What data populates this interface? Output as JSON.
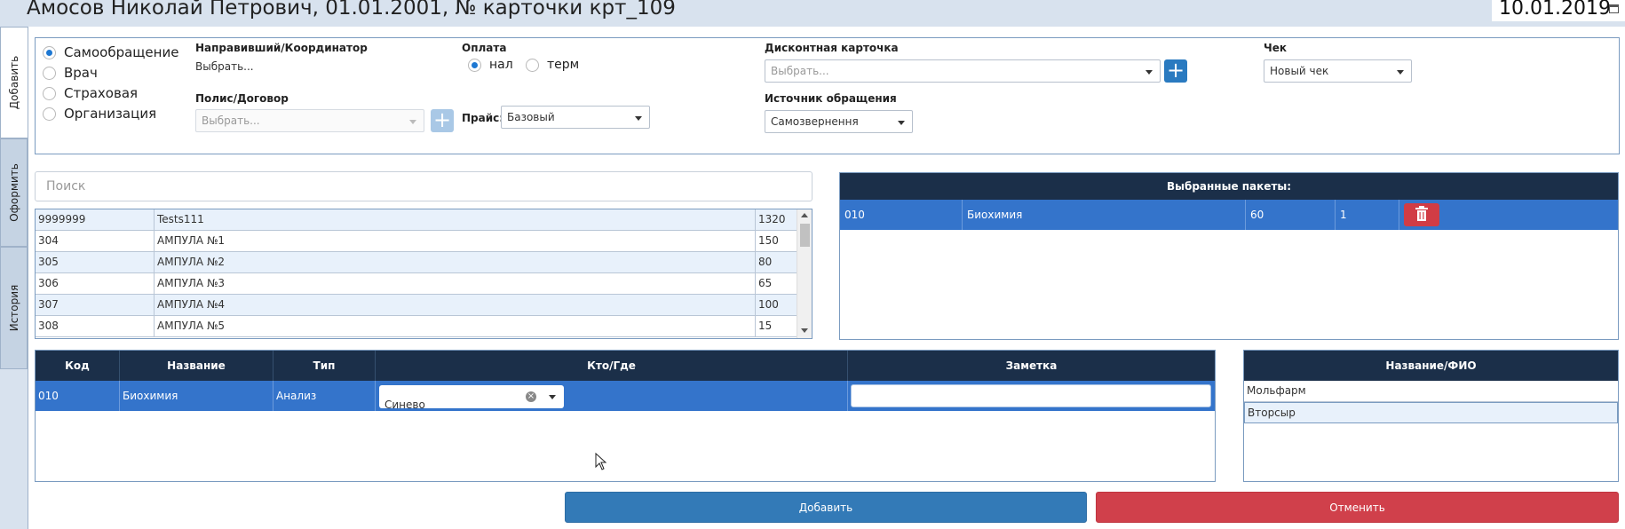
{
  "header": {
    "title": "Амосов Николай Петрович, 01.01.2001, № карточки крт_109",
    "date": "10.01.2019"
  },
  "side_tabs": [
    {
      "label": "Добавить",
      "active": true
    },
    {
      "label": "Оформить",
      "active": false
    },
    {
      "label": "История",
      "active": false
    }
  ],
  "referral_type": {
    "options": [
      "Самообращение",
      "Врач",
      "Страховая",
      "Организация"
    ],
    "selected": "Самообращение"
  },
  "form": {
    "coordinator_label": "Направивший/Координатор",
    "coordinator_value": "Выбрать...",
    "policy_label": "Полис/Договор",
    "policy_placeholder": "Выбрать...",
    "payment_label": "Оплата",
    "payment_options": [
      "нал",
      "терм"
    ],
    "payment_selected": "нал",
    "price_label": "Прайс:",
    "price_value": "Базовый",
    "discount_label": "Дисконтная карточка",
    "discount_placeholder": "Выбрать...",
    "source_label": "Источник обращения",
    "source_value": "Самозвернення",
    "check_label": "Чек",
    "check_value": "Новый чек"
  },
  "search": {
    "placeholder": "Поиск"
  },
  "services": {
    "rows": [
      {
        "code": "9999999",
        "name": "Tests111",
        "price": "1320"
      },
      {
        "code": "304",
        "name": "АМПУЛА №1",
        "price": "150"
      },
      {
        "code": "305",
        "name": "АМПУЛА №2",
        "price": "80"
      },
      {
        "code": "306",
        "name": "АМПУЛА №3",
        "price": "65"
      },
      {
        "code": "307",
        "name": "АМПУЛА №4",
        "price": "100"
      },
      {
        "code": "308",
        "name": "АМПУЛА №5",
        "price": "15"
      }
    ]
  },
  "packages": {
    "title": "Выбранные пакеты:",
    "rows": [
      {
        "code": "010",
        "name": "Биохимия",
        "price": "60",
        "qty": "1"
      }
    ]
  },
  "order": {
    "headers": [
      "Код",
      "Название",
      "Тип",
      "Кто/Где",
      "Заметка"
    ],
    "rows": [
      {
        "code": "010",
        "name": "Биохимия",
        "type": "Анализ",
        "who": "Синево",
        "note": ""
      }
    ]
  },
  "names": {
    "header": "Название/ФИО",
    "rows": [
      "Мольфарм",
      "Вторсыр"
    ]
  },
  "buttons": {
    "add": "Добавить",
    "cancel": "Отменить"
  },
  "colors": {
    "header_bg": "#1b2f49",
    "selected_row": "#3474cb",
    "primary": "#337ab7",
    "danger": "#d0404b",
    "radio_accent": "#1e78d2"
  }
}
